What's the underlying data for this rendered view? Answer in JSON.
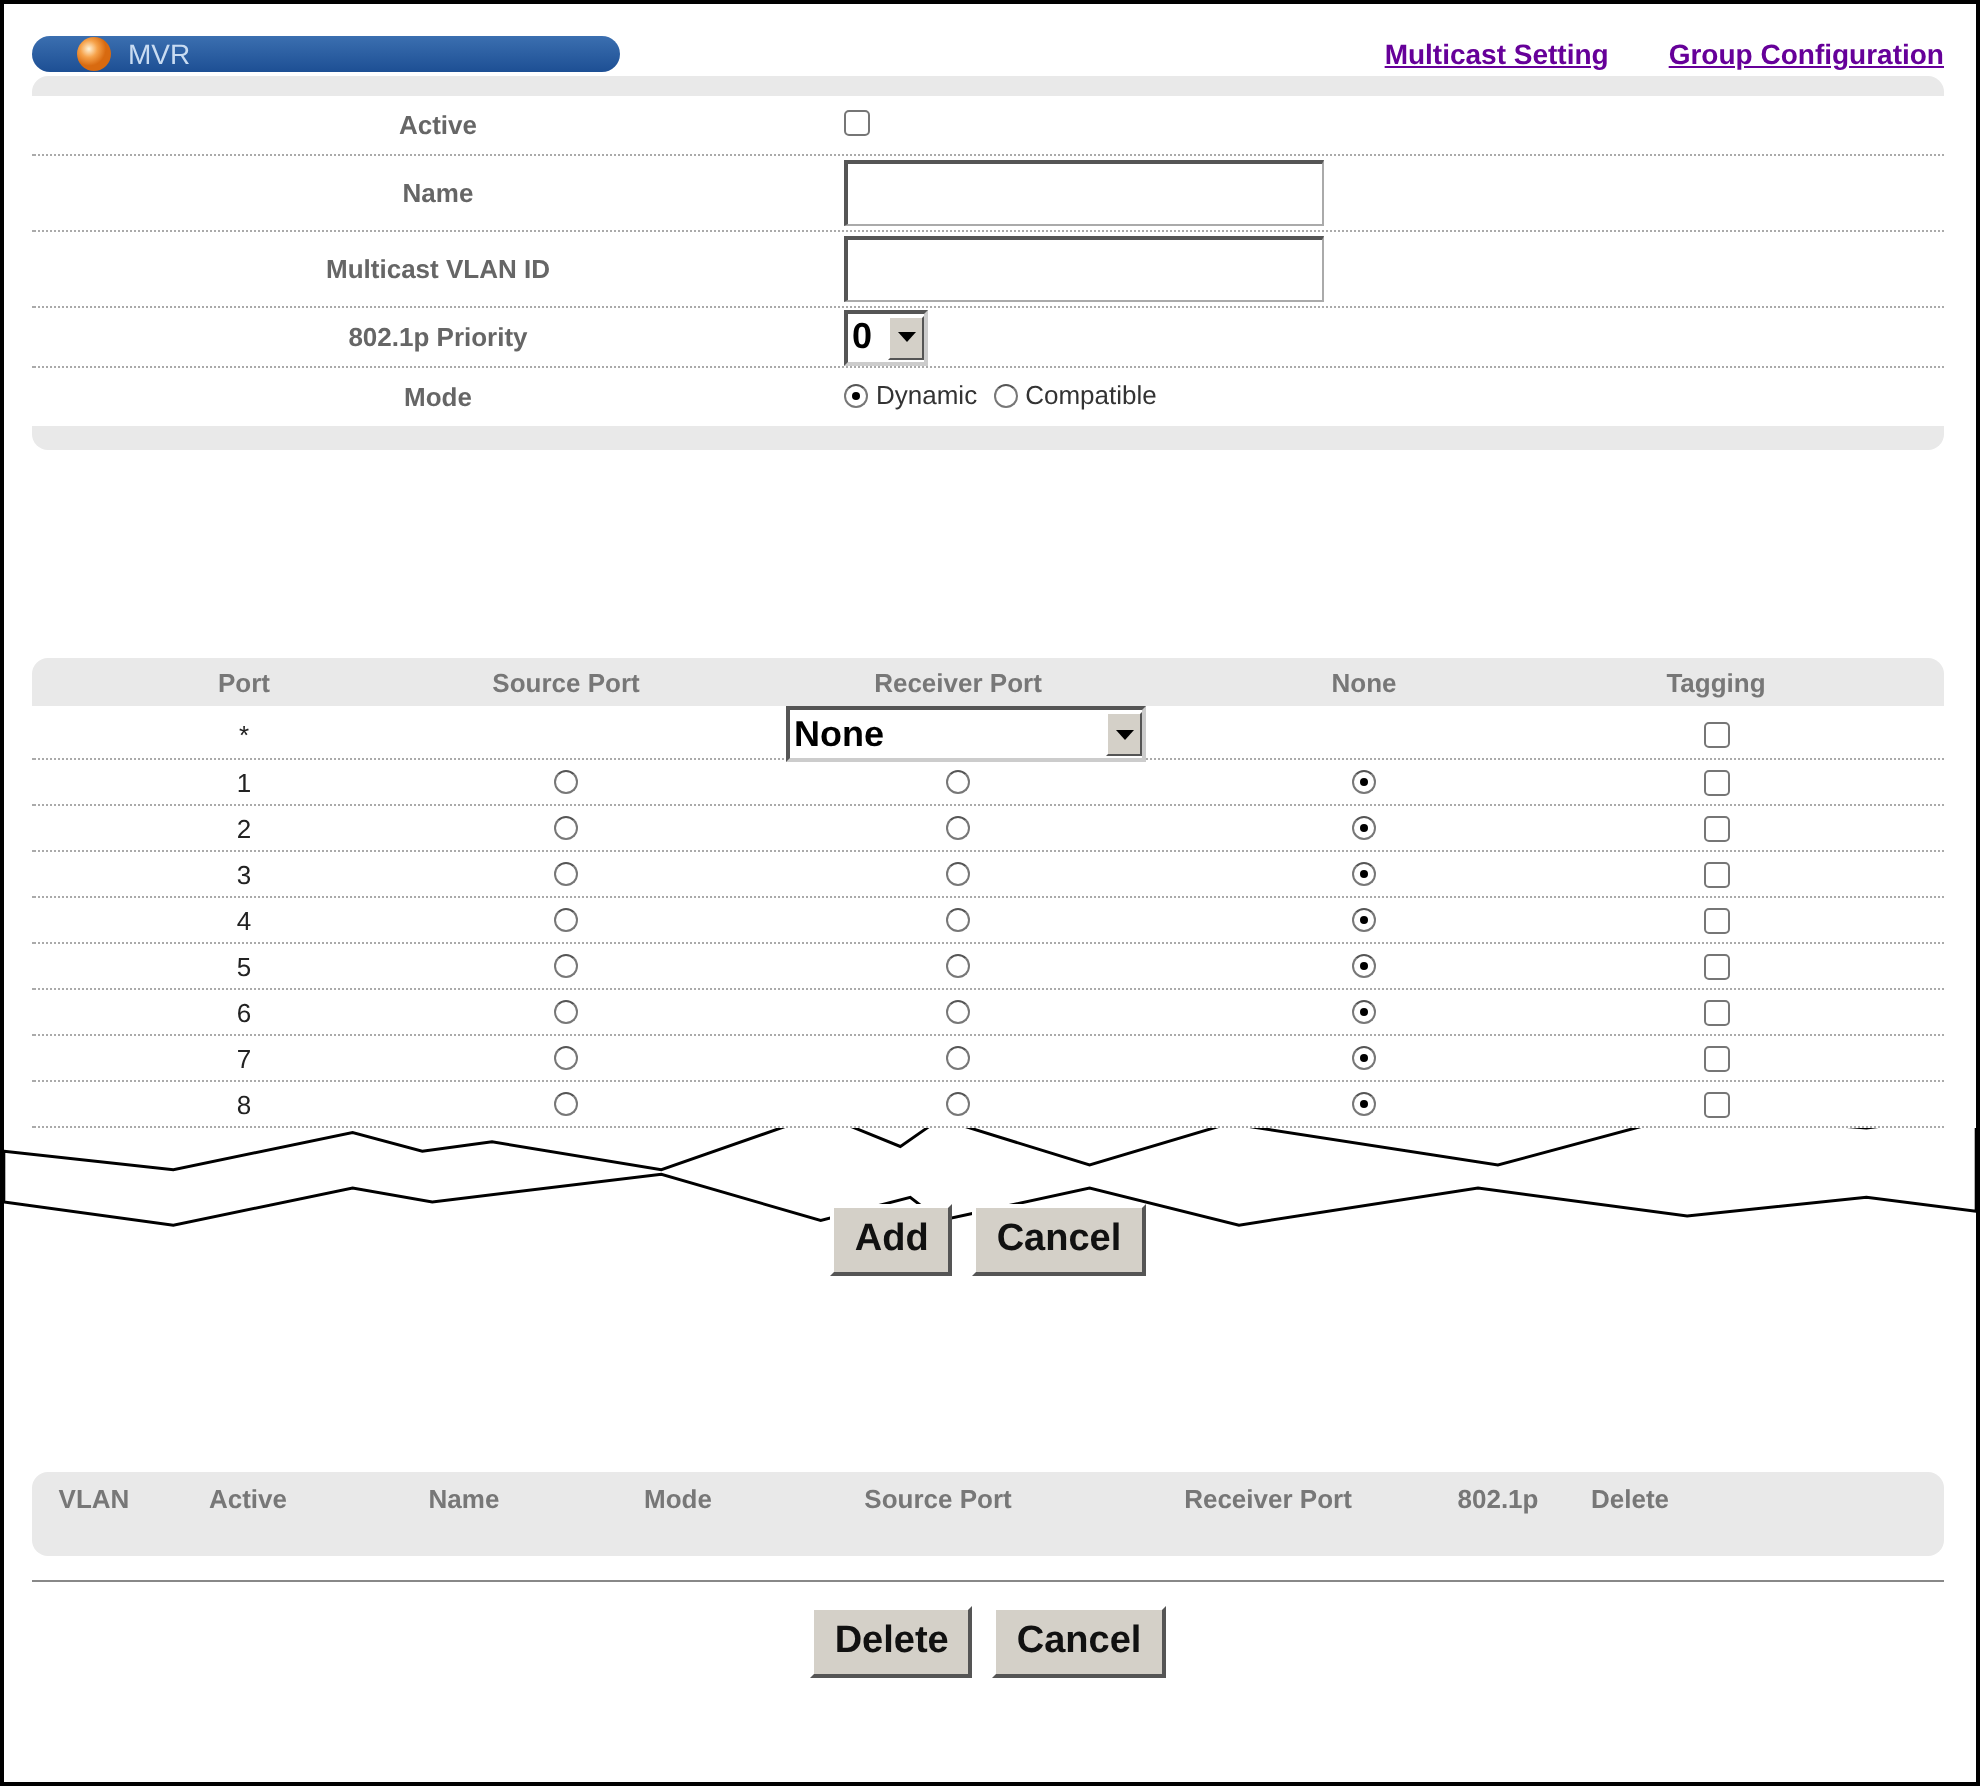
{
  "header": {
    "title": "MVR",
    "links": [
      {
        "label": "Multicast Setting"
      },
      {
        "label": "Group Configuration"
      }
    ]
  },
  "settings": {
    "active": {
      "label": "Active",
      "checked": false
    },
    "name": {
      "label": "Name"
    },
    "vlan_id": {
      "label": "Multicast VLAN ID"
    },
    "priority": {
      "label": "802.1p Priority",
      "value": "0"
    },
    "mode": {
      "label": "Mode",
      "options": [
        {
          "label": "Dynamic",
          "selected": true
        },
        {
          "label": "Compatible",
          "selected": false
        }
      ]
    }
  },
  "port_table": {
    "columns": [
      "Port",
      "Source Port",
      "Receiver Port",
      "None",
      "Tagging"
    ],
    "default_row": {
      "port": "*",
      "receiver_select": "None",
      "tagging": false
    },
    "rows": [
      {
        "port": "1",
        "choices": [
          {
            "selected": false
          },
          {
            "selected": false
          },
          {
            "selected": true
          }
        ],
        "tagging": false
      },
      {
        "port": "2",
        "choices": [
          {
            "selected": false
          },
          {
            "selected": false
          },
          {
            "selected": true
          }
        ],
        "tagging": false
      },
      {
        "port": "3",
        "choices": [
          {
            "selected": false
          },
          {
            "selected": false
          },
          {
            "selected": true
          }
        ],
        "tagging": false
      },
      {
        "port": "4",
        "choices": [
          {
            "selected": false
          },
          {
            "selected": false
          },
          {
            "selected": true
          }
        ],
        "tagging": false
      },
      {
        "port": "5",
        "choices": [
          {
            "selected": false
          },
          {
            "selected": false
          },
          {
            "selected": true
          }
        ],
        "tagging": false
      },
      {
        "port": "6",
        "choices": [
          {
            "selected": false
          },
          {
            "selected": false
          },
          {
            "selected": true
          }
        ],
        "tagging": false
      },
      {
        "port": "7",
        "choices": [
          {
            "selected": false
          },
          {
            "selected": false
          },
          {
            "selected": true
          }
        ],
        "tagging": false
      },
      {
        "port": "8",
        "choices": [
          {
            "selected": false
          },
          {
            "selected": false
          },
          {
            "selected": true
          }
        ],
        "tagging": false
      }
    ]
  },
  "port_buttons": [
    "Add",
    "Cancel"
  ],
  "group_table": {
    "columns": [
      "VLAN",
      "Active",
      "Name",
      "Mode",
      "Source Port",
      "Receiver Port",
      "802.1p",
      "Delete"
    ]
  },
  "group_buttons": [
    "Delete",
    "Cancel"
  ]
}
